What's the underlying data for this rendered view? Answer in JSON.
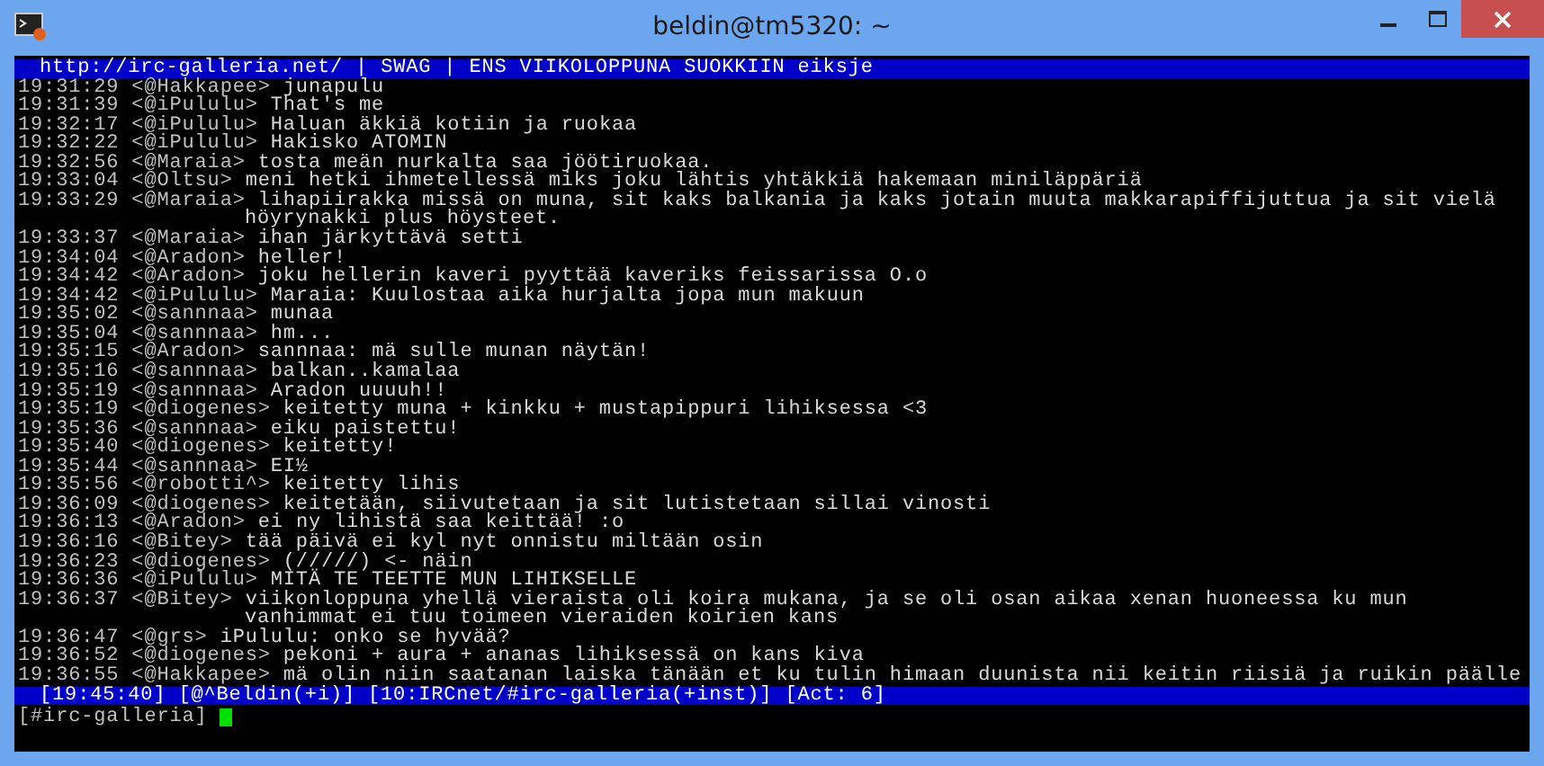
{
  "window": {
    "title": "beldin@tm5320: ~"
  },
  "topic": "http://irc-galleria.net/ | SWAG | ENS VIIKOLOPPUNA SUOKKIIN eiksje",
  "messages": [
    {
      "time": "19:31:29",
      "nick": "<@Hakkapee>",
      "lines": [
        "junapulu"
      ]
    },
    {
      "time": "19:31:39",
      "nick": "<@iPululu>",
      "lines": [
        "That's me"
      ]
    },
    {
      "time": "19:32:17",
      "nick": "<@iPululu>",
      "lines": [
        "Haluan äkkiä kotiin ja ruokaa"
      ]
    },
    {
      "time": "19:32:22",
      "nick": "<@iPululu>",
      "lines": [
        "Hakisko ATOMIN"
      ]
    },
    {
      "time": "19:32:56",
      "nick": "<@Maraia>",
      "lines": [
        "tosta meän nurkalta saa jöötiruokaa."
      ]
    },
    {
      "time": "19:33:04",
      "nick": "<@Oltsu>",
      "lines": [
        "meni hetki ihmetellessä miks joku lähtis yhtäkkiä hakemaan miniläppäriä"
      ]
    },
    {
      "time": "19:33:29",
      "nick": "<@Maraia>",
      "lines": [
        "lihapiirakka missä on muna, sit kaks balkania ja kaks jotain muuta makkarapiffijuttua ja sit vielä",
        "höyrynakki plus höysteet."
      ]
    },
    {
      "time": "19:33:37",
      "nick": "<@Maraia>",
      "lines": [
        "ihan järkyttävä setti"
      ]
    },
    {
      "time": "19:34:04",
      "nick": "<@Aradon>",
      "lines": [
        "heller!"
      ]
    },
    {
      "time": "19:34:42",
      "nick": "<@Aradon>",
      "lines": [
        "joku hellerin kaveri pyyttää kaveriks feissarissa O.o"
      ]
    },
    {
      "time": "19:34:42",
      "nick": "<@iPululu>",
      "lines": [
        "Maraia: Kuulostaa aika hurjalta jopa mun makuun"
      ]
    },
    {
      "time": "19:35:02",
      "nick": "<@sannnaa>",
      "lines": [
        "munaa"
      ]
    },
    {
      "time": "19:35:04",
      "nick": "<@sannnaa>",
      "lines": [
        "hm..."
      ]
    },
    {
      "time": "19:35:15",
      "nick": "<@Aradon>",
      "lines": [
        "sannnaa: mä sulle munan näytän!"
      ]
    },
    {
      "time": "19:35:16",
      "nick": "<@sannnaa>",
      "lines": [
        "balkan..kamalaa"
      ]
    },
    {
      "time": "19:35:19",
      "nick": "<@sannnaa>",
      "lines": [
        "Aradon uuuuh!!"
      ]
    },
    {
      "time": "19:35:19",
      "nick": "<@diogenes>",
      "lines": [
        "keitetty muna + kinkku + mustapippuri lihiksessa <3"
      ]
    },
    {
      "time": "19:35:36",
      "nick": "<@sannnaa>",
      "lines": [
        "eiku paistettu!"
      ]
    },
    {
      "time": "19:35:40",
      "nick": "<@diogenes>",
      "lines": [
        "keitetty!"
      ]
    },
    {
      "time": "19:35:44",
      "nick": "<@sannnaa>",
      "lines": [
        "EI½"
      ]
    },
    {
      "time": "19:35:56",
      "nick": "<@robotti^>",
      "lines": [
        "keitetty lihis"
      ]
    },
    {
      "time": "19:36:09",
      "nick": "<@diogenes>",
      "lines": [
        "keitetään, siivutetaan ja sit lutistetaan sillai vinosti"
      ]
    },
    {
      "time": "19:36:13",
      "nick": "<@Aradon>",
      "lines": [
        "ei ny lihistä saa keittää! :o"
      ]
    },
    {
      "time": "19:36:16",
      "nick": "<@Bitey>",
      "lines": [
        "tää päivä ei kyl nyt onnistu miltään osin"
      ]
    },
    {
      "time": "19:36:23",
      "nick": "<@diogenes>",
      "lines": [
        "(/////) <- näin"
      ]
    },
    {
      "time": "19:36:36",
      "nick": "<@iPululu>",
      "lines": [
        "MITÄ TE TEETTE MUN LIHIKSELLE"
      ]
    },
    {
      "time": "19:36:37",
      "nick": "<@Bitey>",
      "lines": [
        "viikonloppuna yhellä vieraista oli koira mukana, ja se oli osan aikaa xenan huoneessa ku mun",
        "vanhimmat ei tuu toimeen vieraiden koirien kans"
      ]
    },
    {
      "time": "19:36:47",
      "nick": "<@grs>",
      "lines": [
        "iPululu: onko se hyvää?"
      ]
    },
    {
      "time": "19:36:52",
      "nick": "<@diogenes>",
      "lines": [
        "pekoni + aura + ananas lihiksessä on kans kiva"
      ]
    },
    {
      "time": "19:36:55",
      "nick": "<@Hakkapee>",
      "lines": [
        "mä olin niin saatanan laiska tänään et ku tulin himaan duunista nii keitin riisiä ja ruikin päälle"
      ]
    }
  ],
  "status_bar": [
    "[19:45:40]",
    "[@^Beldin(+i)]",
    "[10:IRCnet/#irc-galleria(+inst)]",
    "[Act: 6]"
  ],
  "input": {
    "prompt": "[#irc-galleria]"
  }
}
